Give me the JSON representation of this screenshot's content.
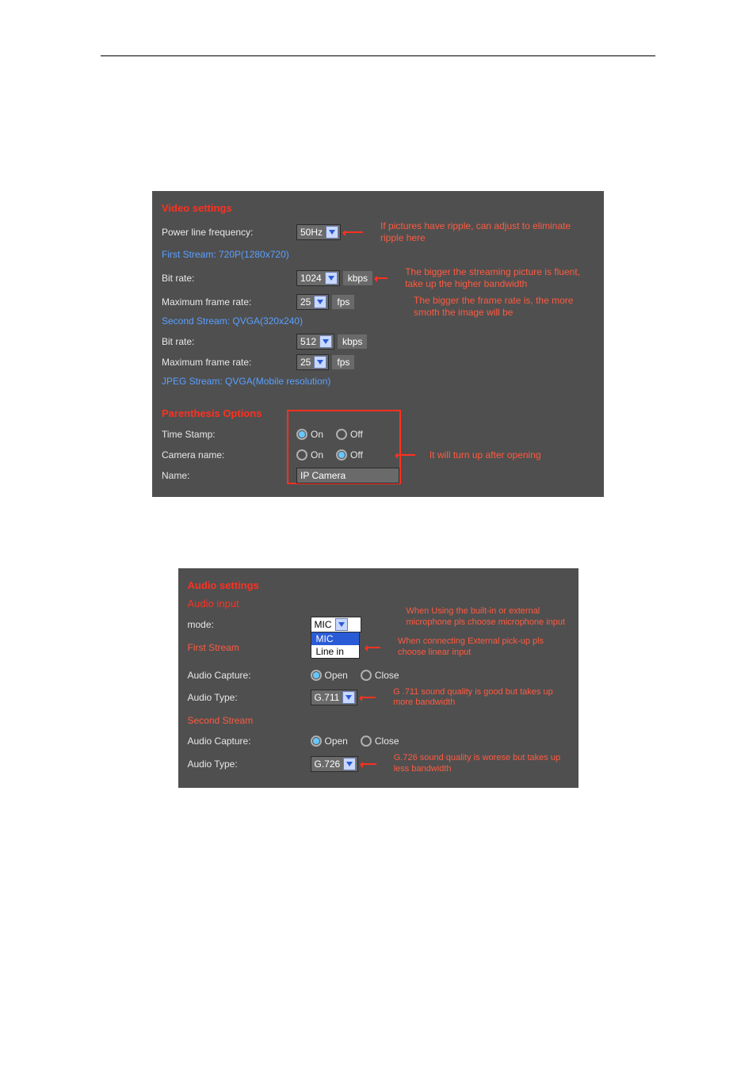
{
  "panel1": {
    "title": "Video settings",
    "power_line_label": "Power line frequency:",
    "power_line_value": "50Hz",
    "power_line_annot": "If pictures have ripple, can adjust to eliminate ripple here",
    "first_stream_title": "First Stream: 720P(1280x720)",
    "bitrate1_label": "Bit rate:",
    "bitrate1_value": "1024",
    "kbps": "kbps",
    "bitrate1_annot": "The bigger the streaming picture is fluent, take up the higher bandwidth",
    "fps1_label": "Maximum frame rate:",
    "fps1_value": "25",
    "fps": "fps",
    "fps1_annot": "The bigger the frame rate is, the more smoth the image will be",
    "second_stream_title": "Second Stream: QVGA(320x240)",
    "bitrate2_label": "Bit rate:",
    "bitrate2_value": "512",
    "fps2_label": "Maximum frame rate:",
    "fps2_value": "25",
    "jpeg_title": "JPEG Stream: QVGA(Mobile resolution)",
    "parenthesis_title": "Parenthesis Options",
    "timestamp_label": "Time Stamp:",
    "timestamp_annot": "It will turn up after opening",
    "camname_label": "Camera name:",
    "name_label": "Name:",
    "name_value": "IP Camera",
    "on": "On",
    "off": "Off"
  },
  "panel2": {
    "title": "Audio settings",
    "input_title": "Audio input",
    "mode_label": "mode:",
    "mode_value": "MIC",
    "mode_open_sel": "MIC",
    "mode_open_other": "Line in",
    "mode_annot1": "When Using the built-in or external microphone pls choose microphone input",
    "mode_annot2": "When connecting External pick-up pls choose linear input",
    "first_stream": "First Stream",
    "second_stream": "Second Stream",
    "cap_label": "Audio Capture:",
    "type_label": "Audio Type:",
    "type1_value": "G.711",
    "type1_annot": "G .711 sound quality is good but takes up more bandwidth",
    "type2_value": "G.726",
    "type2_annot": "G.726 sound quality is worese but takes up less bandwidth",
    "open": "Open",
    "close": "Close"
  }
}
